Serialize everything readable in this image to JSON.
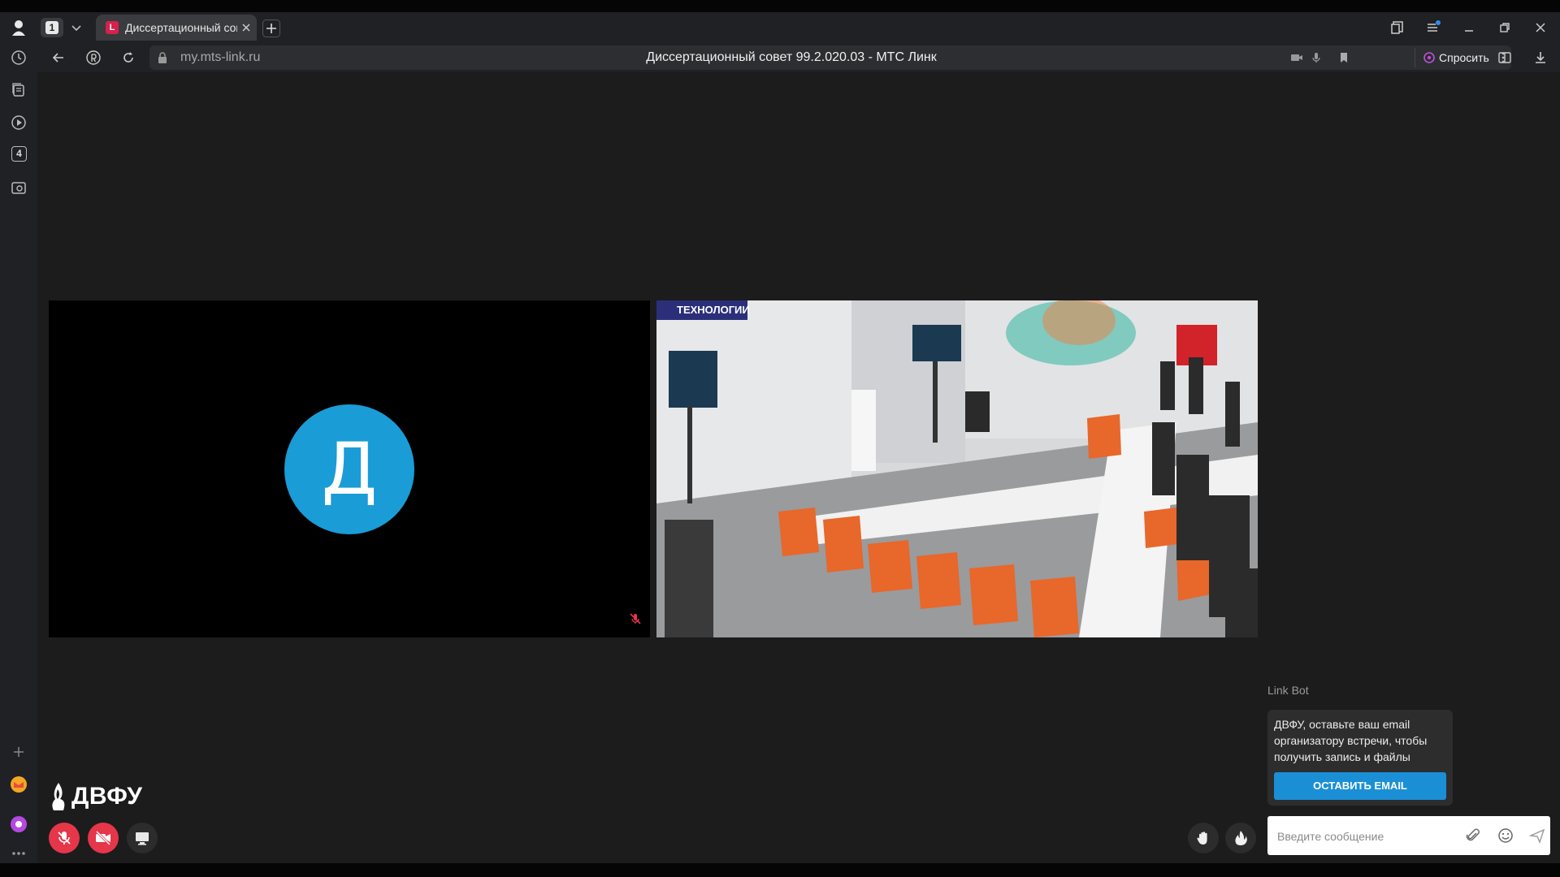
{
  "browser": {
    "tab_count": "1",
    "tab_title": "Диссертационный совет 99.2.020.03 - МТС Линк",
    "tab_favicon_letter": "L",
    "url": "my.mts-link.ru",
    "page_title": "Диссертационный совет 99.2.020.03 - МТС Линк",
    "ask_label": "Спросить",
    "sidebar_badge": "4"
  },
  "conference": {
    "participant_initial": "Д",
    "avatar_color": "#1a9cd6",
    "logo_text": "ДВФУ",
    "camera_banner_text": "ТЕХНОЛОГИИ"
  },
  "chat": {
    "bot_name": "Link Bot",
    "bot_message": "ДВФУ, оставьте ваш email организатору встречи, чтобы получить запись и файлы",
    "email_button": "ОСТАВИТЬ EMAIL",
    "input_placeholder": "Введите сообщение",
    "input_value": ""
  },
  "colors": {
    "danger": "#e5364a",
    "accent": "#1a8fd6"
  }
}
